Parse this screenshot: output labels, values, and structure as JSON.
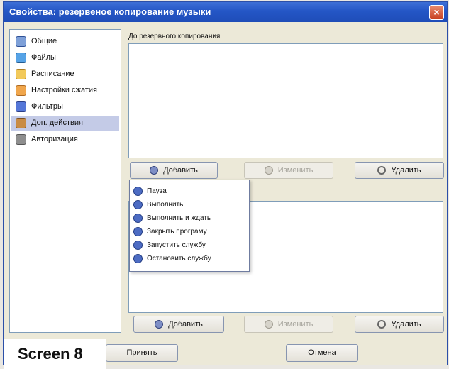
{
  "window": {
    "title": "Свойства: резервеное копирование музыки"
  },
  "sidebar": {
    "items": [
      {
        "label": "Общие",
        "icon": "general-icon"
      },
      {
        "label": "Файлы",
        "icon": "files-icon"
      },
      {
        "label": "Расписание",
        "icon": "schedule-icon"
      },
      {
        "label": "Настройки сжатия",
        "icon": "compression-icon"
      },
      {
        "label": "Фильтры",
        "icon": "filters-icon"
      },
      {
        "label": "Доп. действия",
        "icon": "actions-icon"
      },
      {
        "label": "Авторизация",
        "icon": "authorization-icon"
      }
    ],
    "selected_label": "Доп. действия"
  },
  "section_top": {
    "label": "До резервного копирования"
  },
  "buttons": {
    "add": "Добавить",
    "edit": "Изменить",
    "delete": "Удалить"
  },
  "menu": {
    "items": [
      "Пауза",
      "Выполнить",
      "Выполнить и ждать",
      "Закрыть програму",
      "Запустить службу",
      "Остановить службу"
    ]
  },
  "footer": {
    "apply": "Принять",
    "cancel": "Отмена"
  },
  "screen_label": "Screen 8"
}
